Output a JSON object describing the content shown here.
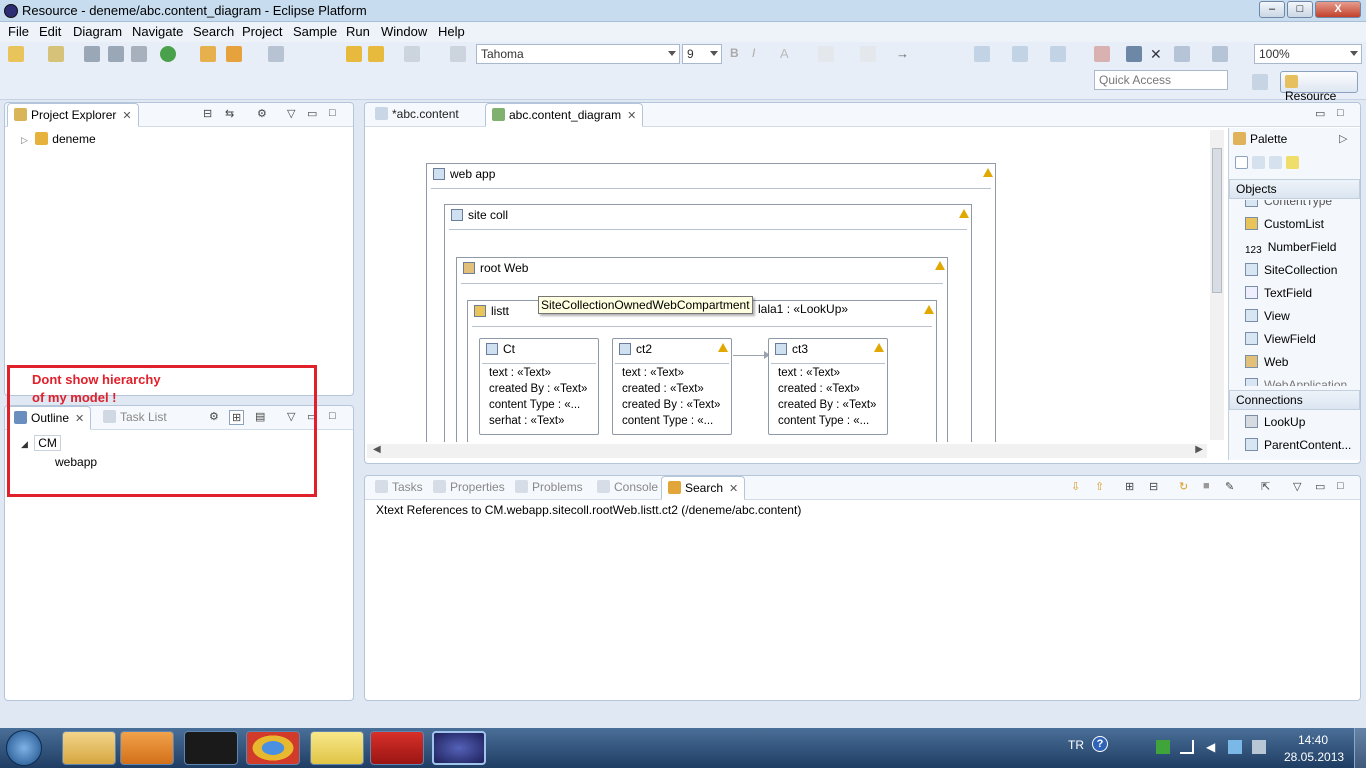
{
  "window": {
    "title": "Resource - deneme/abc.content_diagram - Eclipse Platform",
    "min": "–",
    "max": "□",
    "close": "X"
  },
  "menu": [
    "File",
    "Edit",
    "Diagram",
    "Navigate",
    "Search",
    "Project",
    "Sample",
    "Run",
    "Window",
    "Help"
  ],
  "toolbar": {
    "font_value": "Tahoma",
    "size_value": "9",
    "zoom_value": "100%",
    "quick_access_placeholder": "Quick Access",
    "perspective_label": "Resource"
  },
  "project_explorer": {
    "tab_label": "Project Explorer",
    "items": [
      "deneme"
    ]
  },
  "outline": {
    "tab_label": "Outline",
    "other_tab": "Task List",
    "tree": [
      "CM",
      "webapp"
    ]
  },
  "annotation": {
    "line1": "Dont show hierarchy",
    "line2": "of my model !",
    "color": "#e0202a"
  },
  "editor": {
    "tabs": [
      "*abc.content",
      "abc.content_diagram"
    ],
    "nodes": {
      "webapp": "web app",
      "sitecoll": "site coll",
      "rootweb": "root Web",
      "listt": "listt"
    },
    "tooltip": "SiteCollectionOwnedWebCompartment",
    "lookup_label": "lala1 : «LookUp»",
    "ct": {
      "title": "Ct",
      "attrs": [
        "text : «Text»",
        "created By : «Text»",
        "content Type : «...",
        "serhat : «Text»"
      ]
    },
    "ct2": {
      "title": "ct2",
      "attrs": [
        "text : «Text»",
        "created : «Text»",
        "created By : «Text»",
        "content Type : «..."
      ]
    },
    "ct3": {
      "title": "ct3",
      "attrs": [
        "text : «Text»",
        "created : «Text»",
        "created By : «Text»",
        "content Type : «..."
      ]
    }
  },
  "palette": {
    "title": "Palette",
    "objects_label": "Objects",
    "objects": [
      "ContentType",
      "CustomList",
      "NumberField",
      "SiteCollection",
      "TextField",
      "View",
      "ViewField",
      "Web",
      "WebApplication"
    ],
    "connections_label": "Connections",
    "connections": [
      "LookUp",
      "ParentContent..."
    ]
  },
  "bottom": {
    "tabs": [
      "Tasks",
      "Properties",
      "Problems",
      "Console",
      "Search"
    ],
    "search_result": "Xtext References to CM.webapp.sitecoll.rootWeb.listt.ct2 (/deneme/abc.content)"
  },
  "tray": {
    "lang": "TR",
    "time": "14:40",
    "date": "28.05.2013"
  }
}
